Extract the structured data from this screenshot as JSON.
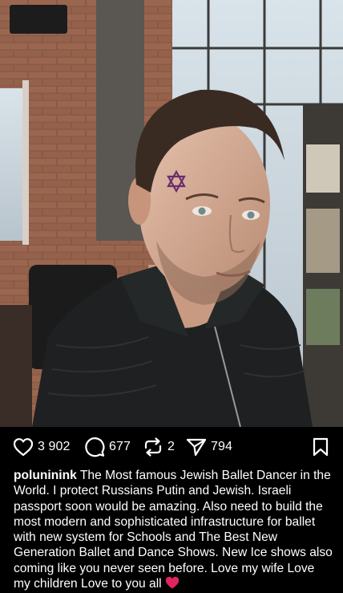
{
  "post": {
    "photo_alt": "",
    "likes": "3 902",
    "comments": "677",
    "reposts": "2",
    "shares": "794",
    "username": "poluninink",
    "caption": "The Most famous Jewish Ballet Dancer in the World. I protect Russians Putin and Jewish. Israeli passport soon would be amazing. Also need to build the most modern and sophisticated infrastructure for ballet with new system for Schools and The Best New Generation Ballet  and Dance Shows. New Ice shows also coming like you never seen before. Love my wife Love my children Love to you all"
  },
  "icons": {
    "like": "heart-icon",
    "comment": "comment-icon",
    "repost": "repost-icon",
    "share": "send-icon",
    "save": "bookmark-icon",
    "caption_emoji": "red-heart-emoji"
  },
  "colors": {
    "background": "#000000",
    "text": "#ffffff",
    "emoji_heart": "#e0245e"
  }
}
